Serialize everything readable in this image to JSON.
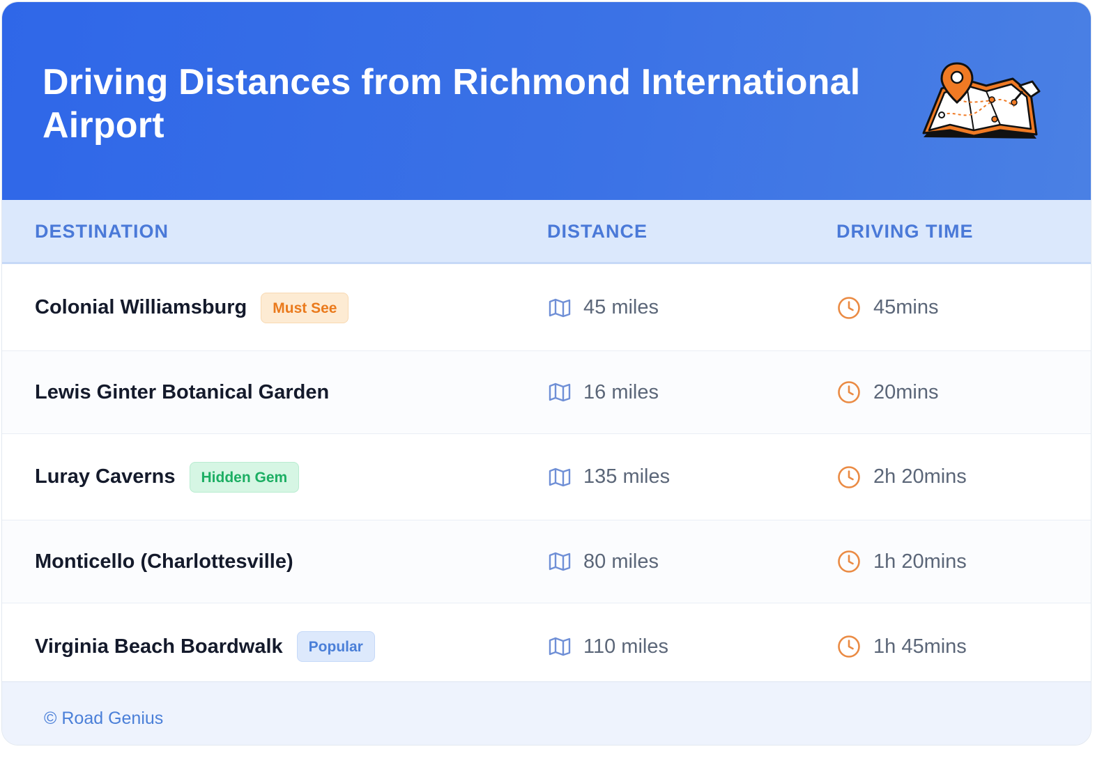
{
  "header": {
    "title": "Driving Distances from Richmond International Airport",
    "illustration_icon": "map-with-pins-icon"
  },
  "columns": {
    "destination": "DESTINATION",
    "distance": "DISTANCE",
    "driving_time": "DRIVING TIME"
  },
  "rows": [
    {
      "destination": "Colonial Williamsburg",
      "badge": "Must See",
      "badge_color": "#ea7a1c",
      "distance": "45 miles",
      "time": "45mins"
    },
    {
      "destination": "Lewis Ginter Botanical Garden",
      "badge": "",
      "distance": "16 miles",
      "time": "20mins"
    },
    {
      "destination": "Luray Caverns",
      "badge": "Hidden Gem",
      "badge_color": "#1cae63",
      "distance": "135 miles",
      "time": "2h 20mins"
    },
    {
      "destination": "Monticello (Charlottesville)",
      "badge": "",
      "distance": "80 miles",
      "time": "1h 20mins"
    },
    {
      "destination": "Virginia Beach Boardwalk",
      "badge": "Popular",
      "badge_color": "#4a7fd8",
      "distance": "110 miles",
      "time": "1h 45mins"
    }
  ],
  "icons": {
    "distance": "map-icon",
    "time": "clock-icon"
  },
  "footer": {
    "text": "© Road Genius"
  },
  "colors": {
    "header": "#2f67e8",
    "accent": "#4a79d8",
    "clock": "#ea8a43"
  }
}
